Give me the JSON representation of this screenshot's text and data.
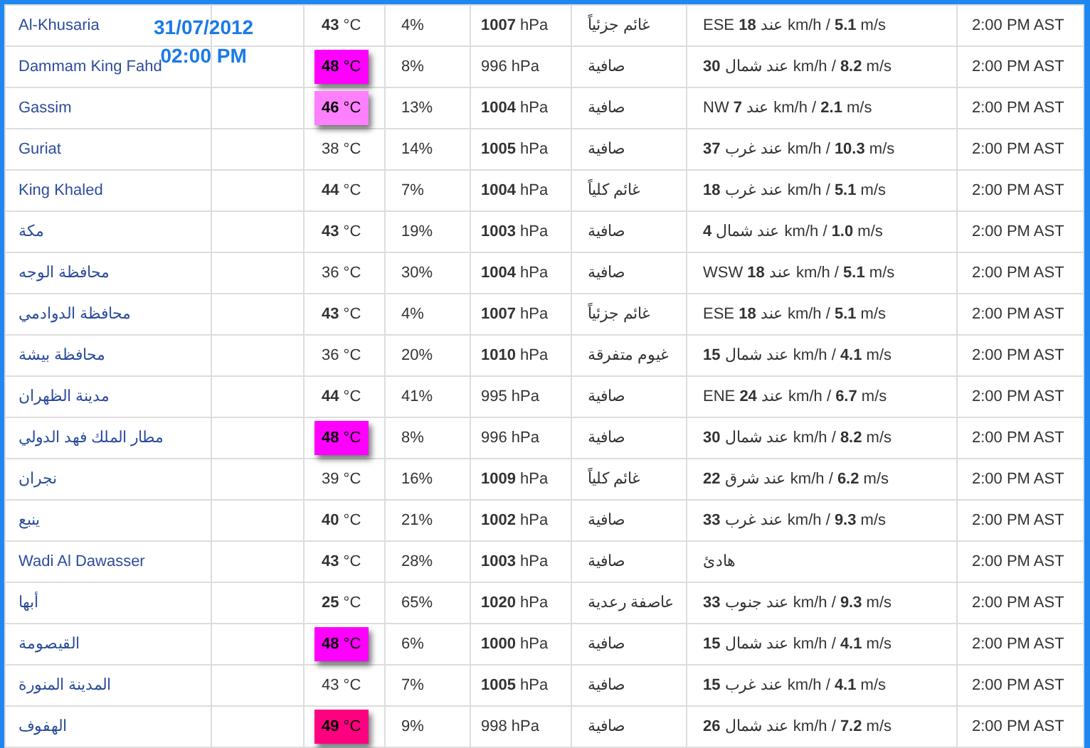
{
  "overlay": {
    "date": "31/07/2012",
    "time": "02:00 PM"
  },
  "rows": [
    {
      "name": "Al-Khusaria",
      "temp": {
        "text": "**43** °C"
      },
      "humidity": "4%",
      "pressure": "**1007** hPa",
      "condition": "غائم جزئياً",
      "wind": "ESE **18** عند km/h / **5.1** m/s",
      "time": "2:00 PM AST"
    },
    {
      "name": "Dammam King Fahd",
      "temp": {
        "text": "**48** °C",
        "color": "#ff00ff"
      },
      "humidity": "8%",
      "pressure": "996 hPa",
      "condition": "صافية",
      "wind": "**30** عند شمال km/h / **8.2** m/s",
      "time": "2:00 PM AST"
    },
    {
      "name": "Gassim",
      "temp": {
        "text": "**46** °C",
        "color": "#ff80ff"
      },
      "humidity": "13%",
      "pressure": "**1004** hPa",
      "condition": "صافية",
      "wind": "NW **7** عند km/h / **2.1** m/s",
      "time": "2:00 PM AST"
    },
    {
      "name": "Guriat",
      "temp": {
        "text": "38 °C"
      },
      "humidity": "14%",
      "pressure": "**1005** hPa",
      "condition": "صافية",
      "wind": "**37** عند غرب km/h / **10.3** m/s",
      "time": "2:00 PM AST"
    },
    {
      "name": "King Khaled",
      "temp": {
        "text": "**44** °C"
      },
      "humidity": "7%",
      "pressure": "**1004** hPa",
      "condition": "غائم كلياً",
      "wind": "**18** عند غرب km/h / **5.1** m/s",
      "time": "2:00 PM AST"
    },
    {
      "name": "مكة",
      "temp": {
        "text": "**43** °C"
      },
      "humidity": "19%",
      "pressure": "**1003** hPa",
      "condition": "صافية",
      "wind": "**4** عند شمال km/h / **1.0** m/s",
      "time": "2:00 PM AST"
    },
    {
      "name": "محافظة الوجه",
      "temp": {
        "text": "36 °C"
      },
      "humidity": "30%",
      "pressure": "**1004** hPa",
      "condition": "صافية",
      "wind": "WSW **18** عند km/h / **5.1** m/s",
      "time": "2:00 PM AST"
    },
    {
      "name": "محافظة الدوادمي",
      "temp": {
        "text": "**43** °C"
      },
      "humidity": "4%",
      "pressure": "**1007** hPa",
      "condition": "غائم جزئياً",
      "wind": "ESE **18** عند km/h / **5.1** m/s",
      "time": "2:00 PM AST"
    },
    {
      "name": "محافظة بيشة",
      "temp": {
        "text": "36 °C"
      },
      "humidity": "20%",
      "pressure": "**1010** hPa",
      "condition": "غيوم متفرقة",
      "wind": "**15** عند شمال km/h / **4.1** m/s",
      "time": "2:00 PM AST"
    },
    {
      "name": "مدينة الظهران",
      "temp": {
        "text": "**44** °C"
      },
      "humidity": "41%",
      "pressure": "995 hPa",
      "condition": "صافية",
      "wind": "ENE **24** عند km/h / **6.7** m/s",
      "time": "2:00 PM AST"
    },
    {
      "name": "مطار الملك فهد الدولي",
      "temp": {
        "text": "**48** °C",
        "color": "#ff00ff"
      },
      "humidity": "8%",
      "pressure": "996 hPa",
      "condition": "صافية",
      "wind": "**30** عند شمال km/h / **8.2** m/s",
      "time": "2:00 PM AST"
    },
    {
      "name": "نجران",
      "temp": {
        "text": "39 °C"
      },
      "humidity": "16%",
      "pressure": "**1009** hPa",
      "condition": "غائم كلياً",
      "wind": "**22** عند شرق km/h / **6.2** m/s",
      "time": "2:00 PM AST"
    },
    {
      "name": "ينبع",
      "temp": {
        "text": "**40** °C"
      },
      "humidity": "21%",
      "pressure": "**1002** hPa",
      "condition": "صافية",
      "wind": "**33** عند غرب km/h / **9.3** m/s",
      "time": "2:00 PM AST"
    },
    {
      "name": "Wadi Al Dawasser",
      "temp": {
        "text": "**43** °C"
      },
      "humidity": "28%",
      "pressure": "**1003** hPa",
      "condition": "صافية",
      "wind": "هادئ",
      "time": "2:00 PM AST"
    },
    {
      "name": "أبها",
      "temp": {
        "text": "**25** °C"
      },
      "humidity": "65%",
      "pressure": "**1020** hPa",
      "condition": "عاصفة رعدية",
      "wind": "**33** عند جنوب km/h / **9.3** m/s",
      "time": "2:00 PM AST"
    },
    {
      "name": "القيصومة",
      "temp": {
        "text": "**48** °C",
        "color": "#ff00ff"
      },
      "humidity": "6%",
      "pressure": "**1000** hPa",
      "condition": "صافية",
      "wind": "**15** عند شمال km/h / **4.1** m/s",
      "time": "2:00 PM AST"
    },
    {
      "name": "المدينة المنورة",
      "temp": {
        "text": "43 °C"
      },
      "humidity": "7%",
      "pressure": "**1005** hPa",
      "condition": "صافية",
      "wind": "**15** عند غرب km/h / **4.1** m/s",
      "time": "2:00 PM AST"
    },
    {
      "name": "الهفوف",
      "temp": {
        "text": "**49** °C",
        "color": "#ff0080"
      },
      "humidity": "9%",
      "pressure": "998 hPa",
      "condition": "صافية",
      "wind": "**26** عند شمال km/h / **7.2** m/s",
      "time": "2:00 PM AST"
    }
  ]
}
